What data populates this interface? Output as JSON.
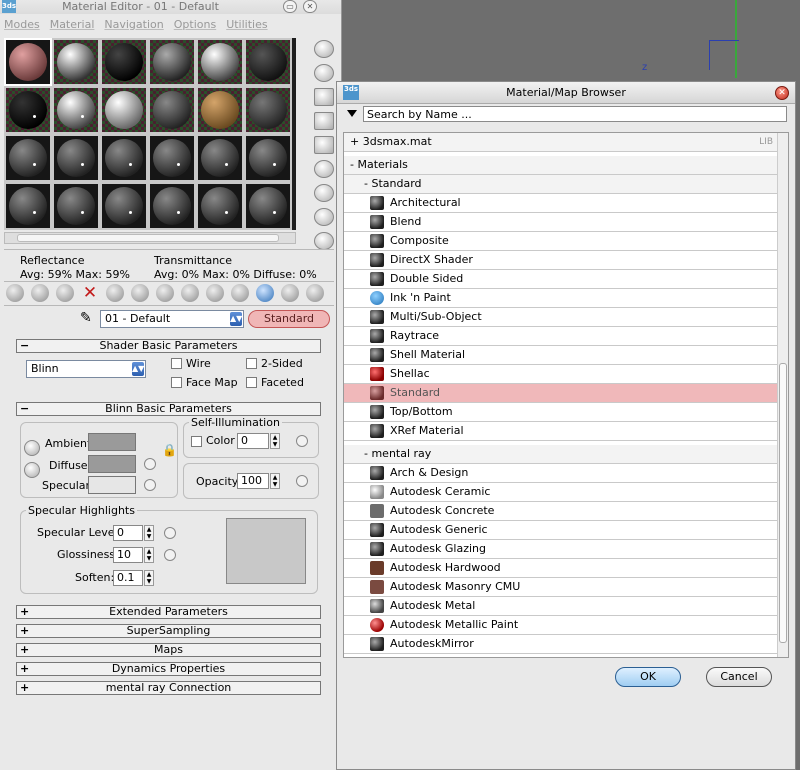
{
  "editor": {
    "title": "Material Editor - 01 - Default",
    "app_logo": "3ds",
    "window_buttons": [
      "minimize-icon",
      "close-icon"
    ],
    "menu": [
      "Modes",
      "Material",
      "Navigation",
      "Options",
      "Utilities"
    ],
    "reflectance_label": "Reflectance",
    "reflectance_values": "Avg:  59% Max:  59%",
    "transmittance_label": "Transmittance",
    "transmittance_values": "Avg:   0% Max:    0%  Diffuse:    0%",
    "material_name": "01 - Default",
    "material_type": "Standard",
    "rollouts": {
      "shader": "Shader Basic Parameters",
      "blinn": "Blinn Basic Parameters",
      "extended": "Extended Parameters",
      "supersampling": "SuperSampling",
      "maps": "Maps",
      "dynamics": "Dynamics Properties",
      "mentalray": "mental ray Connection"
    },
    "shader_value": "Blinn",
    "wire": "Wire",
    "two_sided": "2-Sided",
    "face_map": "Face Map",
    "faceted": "Faceted",
    "ambient": "Ambient:",
    "diffuse": "Diffuse:",
    "specular": "Specular:",
    "self_illum_title": "Self-Illumination",
    "color_label": "Color",
    "self_illum_value": "0",
    "opacity_label": "Opacity:",
    "opacity_value": "100",
    "spec_highlights_title": "Specular Highlights",
    "spec_level_label": "Specular Level:",
    "spec_level_value": "0",
    "glossiness_label": "Glossiness:",
    "glossiness_value": "10",
    "soften_label": "Soften:",
    "soften_value": "0.1",
    "colors": {
      "ambient": "#9a9a9a",
      "diffuse": "#9a9a9a",
      "specular": "#e6e6e6",
      "accent": "#f0b6b6"
    }
  },
  "browser": {
    "title": "Material/Map Browser",
    "logo": "3ds",
    "search_placeholder": "Search by Name ...",
    "library_label": "+ 3dsmax.mat",
    "library_tag": "LIB",
    "materials_label": "- Materials",
    "standard_group": "- Standard",
    "standard_items": [
      "Architectural",
      "Blend",
      "Composite",
      "DirectX Shader",
      "Double Sided",
      "Ink 'n Paint",
      "Multi/Sub-Object",
      "Raytrace",
      "Shell Material",
      "Shellac",
      "Standard",
      "Top/Bottom",
      "XRef Material"
    ],
    "mentalray_group": "- mental ray",
    "mentalray_items": [
      "Arch & Design",
      "Autodesk Ceramic",
      "Autodesk Concrete",
      "Autodesk Generic",
      "Autodesk Glazing",
      "Autodesk Hardwood",
      "Autodesk Masonry CMU",
      "Autodesk Metal",
      "Autodesk Metallic Paint",
      "AutodeskMirror"
    ],
    "ok": "OK",
    "cancel": "Cancel",
    "selected_color": "#f0b8ba"
  },
  "viewport": {
    "axis_label": "z"
  }
}
